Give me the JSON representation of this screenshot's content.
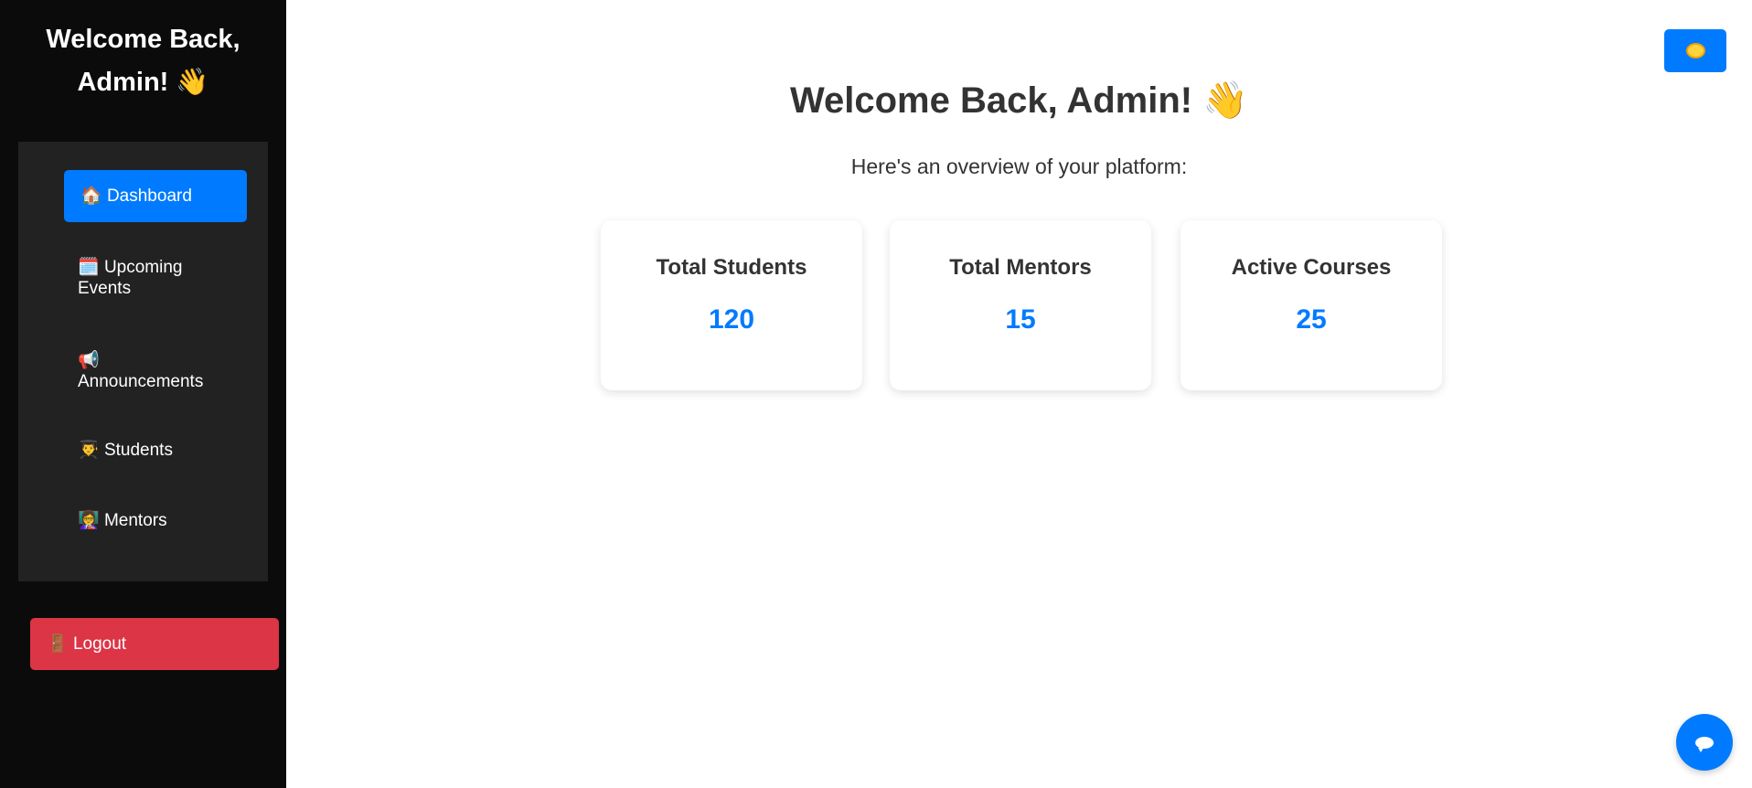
{
  "sidebar": {
    "title_line1": "Welcome Back,",
    "title_line2": "Admin! 👋",
    "items": [
      {
        "icon": "🏠",
        "label": "Dashboard",
        "active": true
      },
      {
        "icon": "🗓️",
        "label": "Upcoming Events"
      },
      {
        "icon": "📢",
        "label": "Announcements"
      },
      {
        "icon": "👨‍🎓",
        "label": "Students"
      },
      {
        "icon": "👩‍🏫",
        "label": "Mentors"
      }
    ],
    "logout": {
      "icon": "🚪",
      "label": "Logout"
    }
  },
  "main": {
    "title": "Welcome Back, Admin! 👋",
    "subtitle": "Here's an overview of your platform:",
    "cards": [
      {
        "title": "Total Students",
        "value": "120"
      },
      {
        "title": "Total Mentors",
        "value": "15"
      },
      {
        "title": "Active Courses",
        "value": "25"
      }
    ]
  },
  "theme_toggle": {
    "icon": "sun-icon"
  },
  "chat_button": {
    "icon": "chat-bubble-icon"
  },
  "colors": {
    "accent": "#007bff",
    "danger": "#dc3545",
    "sidebar": "#0b0b0b",
    "nav_panel": "#222222"
  }
}
